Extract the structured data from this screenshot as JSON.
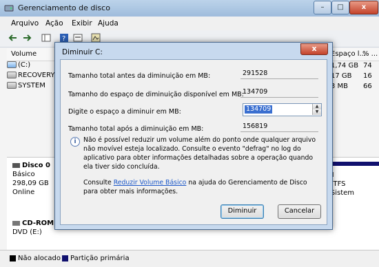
{
  "window": {
    "title": "Gerenciamento de disco"
  },
  "menu": [
    "Arquivo",
    "Ação",
    "Exibir",
    "Ajuda"
  ],
  "table": {
    "col_volume": "Volume",
    "col_free": "Espaço l...",
    "col_pct": "% ...",
    "rows": [
      {
        "name": "(C:)",
        "free": "1,74 GB",
        "pct": "74"
      },
      {
        "name": "RECOVERY (D:)",
        "free": "17 GB",
        "pct": "16"
      },
      {
        "name": "SYSTEM",
        "free": "3 MB",
        "pct": "66"
      }
    ]
  },
  "disk0": {
    "name": "Disco 0",
    "type": "Básico",
    "size": "298,09 GB",
    "status": "Online",
    "part_fs": "NTFS",
    "part_label": "M",
    "part_status": "(Sistem"
  },
  "cdrom": {
    "name": "CD-ROM 0",
    "drive": "DVD (E:)"
  },
  "legend": {
    "unallocated": "Não alocado",
    "primary": "Partição primária",
    "unallocated_color": "#000000",
    "primary_color": "#10106e"
  },
  "dialog": {
    "title": "Diminuir C:",
    "total_before_label": "Tamanho total antes da diminuição em MB:",
    "total_before": "291528",
    "available_label": "Tamanho do espaço de diminuição disponível em MB:",
    "available": "134709",
    "enter_label": "Digite o espaço a diminuir em MB:",
    "enter_value": "134709",
    "total_after_label": "Tamanho total após a diminuição em MB:",
    "total_after": "156819",
    "info_text": "Não é possível reduzir um volume além do ponto onde qualquer arquivo não movível esteja localizado. Consulte o evento \"defrag\" no log do aplicativo para obter informações detalhadas sobre a operação quando ela tiver sido concluída.",
    "consult_prefix": "Consulte",
    "consult_link": "Reduzir Volume Básico",
    "consult_suffix": "na ajuda do Gerenciamento de Disco para obter mais informações.",
    "shrink_button": "Diminuir",
    "cancel_button": "Cancelar"
  }
}
